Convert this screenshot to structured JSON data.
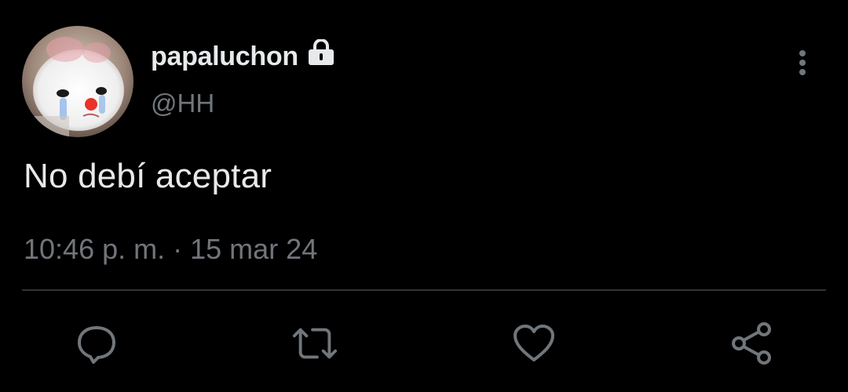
{
  "tweet": {
    "display_name": "papaluchon",
    "handle": "@HH",
    "text": "No debí aceptar",
    "time": "10:46 p. m.",
    "separator": "·",
    "date": "15 mar 24",
    "account_protected_icon": "lock-icon",
    "avatar": "clown-cat-avatar"
  },
  "actions": [
    {
      "name": "reply",
      "icon": "reply-bubble-icon"
    },
    {
      "name": "retweet",
      "icon": "retweet-icon"
    },
    {
      "name": "like",
      "icon": "heart-icon"
    },
    {
      "name": "share",
      "icon": "share-icon"
    }
  ],
  "colors": {
    "background": "#000000",
    "primary_text": "#e7e9ea",
    "secondary_text": "#71767b",
    "divider": "#2f3336",
    "icon": "#71767b"
  }
}
